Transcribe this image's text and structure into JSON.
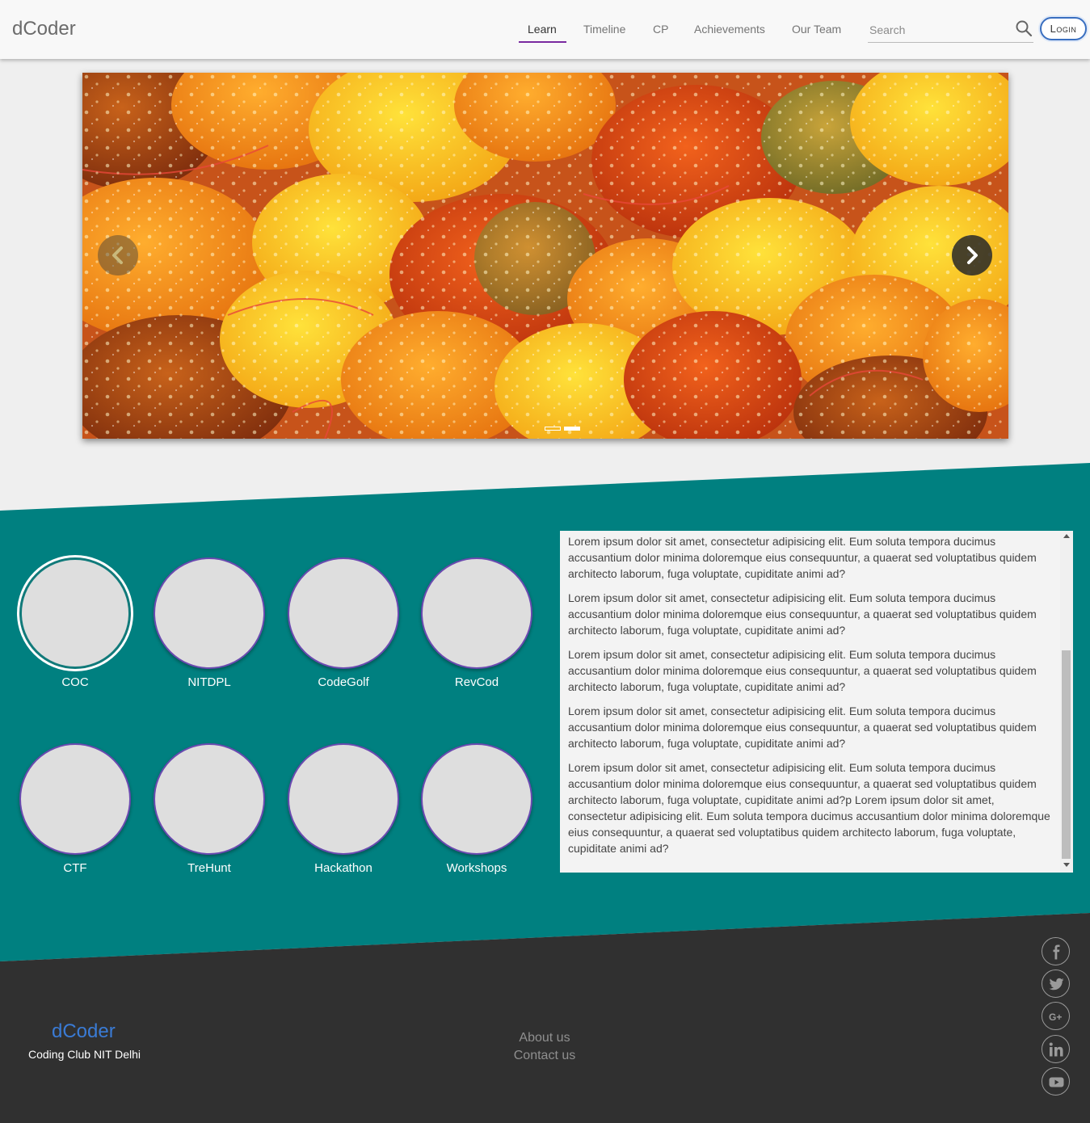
{
  "header": {
    "brand": "dCoder",
    "nav": [
      "Learn",
      "Timeline",
      "CP",
      "Achievements",
      "Our Team"
    ],
    "active_nav": "Learn",
    "search_placeholder": "Search",
    "login_label": "Login"
  },
  "carousel": {
    "slide_count": 2,
    "active_slide": 2,
    "prev_icon": "chevron-left-icon",
    "next_icon": "chevron-right-icon"
  },
  "events": {
    "items": [
      "COC",
      "NITDPL",
      "CodeGolf",
      "RevCod",
      "CTF",
      "TreHunt",
      "Hackathon",
      "Workshops"
    ],
    "selected": "COC"
  },
  "description": {
    "paragraphs": [
      "Lorem ipsum dolor sit amet, consectetur adipisicing elit. Eum soluta tempora ducimus accusantium dolor minima doloremque eius consequuntur, a quaerat sed voluptatibus quidem architecto laborum, fuga voluptate, cupiditate animi ad?",
      "Lorem ipsum dolor sit amet, consectetur adipisicing elit. Eum soluta tempora ducimus accusantium dolor minima doloremque eius consequuntur, a quaerat sed voluptatibus quidem architecto laborum, fuga voluptate, cupiditate animi ad?",
      "Lorem ipsum dolor sit amet, consectetur adipisicing elit. Eum soluta tempora ducimus accusantium dolor minima doloremque eius consequuntur, a quaerat sed voluptatibus quidem architecto laborum, fuga voluptate, cupiditate animi ad?",
      "Lorem ipsum dolor sit amet, consectetur adipisicing elit. Eum soluta tempora ducimus accusantium dolor minima doloremque eius consequuntur, a quaerat sed voluptatibus quidem architecto laborum, fuga voluptate, cupiditate animi ad?",
      "Lorem ipsum dolor sit amet, consectetur adipisicing elit. Eum soluta tempora ducimus accusantium dolor minima doloremque eius consequuntur, a quaerat sed voluptatibus quidem architecto laborum, fuga voluptate, cupiditate animi ad?p Lorem ipsum dolor sit amet, consectetur adipisicing elit. Eum soluta tempora ducimus accusantium dolor minima doloremque eius consequuntur, a quaerat sed voluptatibus quidem architecto laborum, fuga voluptate, cupiditate animi ad?"
    ]
  },
  "footer": {
    "brand": "dCoder",
    "subtitle": "Coding Club NIT Delhi",
    "links": [
      "About us",
      "Contact us"
    ],
    "social_icons": [
      "facebook-icon",
      "twitter-icon",
      "google-plus-icon",
      "linkedin-icon",
      "youtube-icon"
    ]
  },
  "colors": {
    "teal": "#008080",
    "footer": "#303030",
    "accent_underline": "#7a2aa0",
    "circle_border": "#6a4ab0",
    "brand_blue": "#3a7bd5"
  }
}
